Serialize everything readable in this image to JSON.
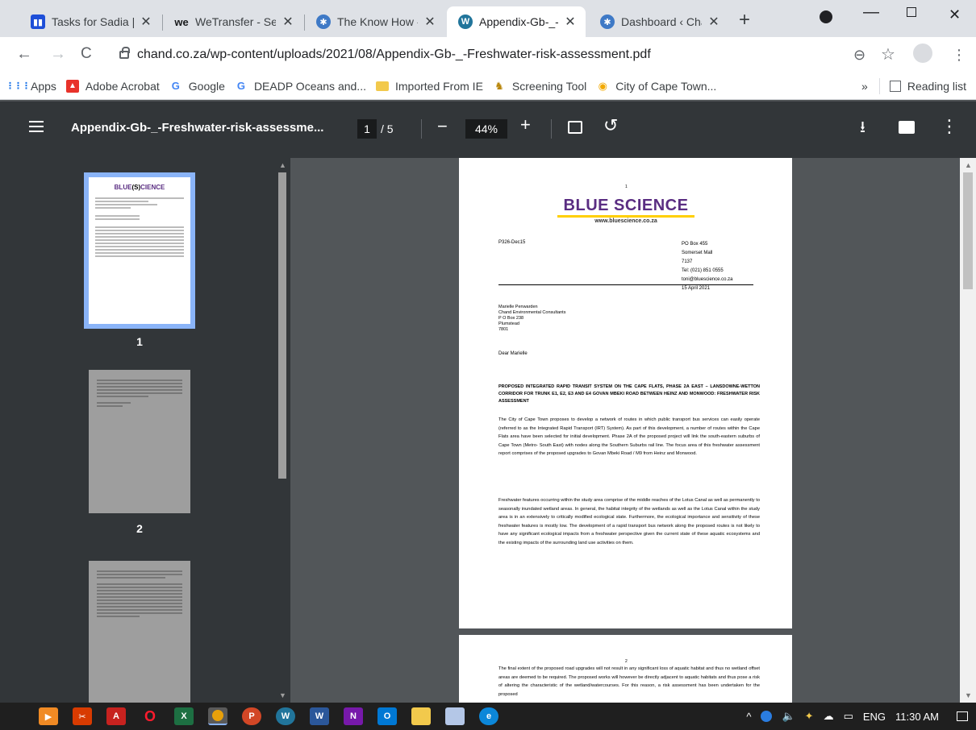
{
  "tabs": [
    {
      "title": "Tasks for Sadia |",
      "favicon": "trello-icon",
      "color": "#0052cc",
      "glyph": "▮▮"
    },
    {
      "title": "WeTransfer - Ser",
      "favicon": "wetransfer-icon",
      "color": "#17181a",
      "glyph": "we"
    },
    {
      "title": "The Know How -",
      "favicon": "cogs-icon",
      "color": "#3e79c6",
      "glyph": "✱"
    },
    {
      "title": "Appendix-Gb-_-",
      "favicon": "wordpress-icon",
      "color": "#21759b",
      "glyph": "W"
    },
    {
      "title": "Dashboard ‹ Cha",
      "favicon": "cogs-icon",
      "color": "#3e79c6",
      "glyph": "✱"
    }
  ],
  "address_bar": {
    "url": "chand.co.za/wp-content/uploads/2021/08/Appendix-Gb-_-Freshwater-risk-assessment.pdf"
  },
  "bookmarks": {
    "items": [
      {
        "label": "Apps",
        "icon": "apps-grid-icon",
        "color": "#1a73e8",
        "glyph": "⋮⋮"
      },
      {
        "label": "Adobe Acrobat",
        "icon": "adobe-acrobat-icon",
        "color": "#e8322a",
        "glyph": "▲"
      },
      {
        "label": "Google",
        "icon": "google-icon",
        "color": "#4285f4",
        "glyph": "G"
      },
      {
        "label": "DEADP Oceans and...",
        "icon": "google-icon",
        "color": "#4285f4",
        "glyph": "G"
      },
      {
        "label": "Imported From IE",
        "icon": "folder-icon",
        "color": "#f2c94c",
        "glyph": "▬"
      },
      {
        "label": "Screening Tool",
        "icon": "coat-of-arms-icon",
        "color": "#b8860b",
        "glyph": "♞"
      },
      {
        "label": "City of Cape Town...",
        "icon": "cape-town-logo-icon",
        "color": "#f2a900",
        "glyph": "◉"
      }
    ],
    "more": "»",
    "reading_list": "Reading list"
  },
  "pdf_toolbar": {
    "title": "Appendix-Gb-_-Freshwater-risk-assessme...",
    "current_page": "1",
    "total_pages": "/ 5",
    "zoom": "44%"
  },
  "sidebar": {
    "thumbnails": [
      {
        "number": "1",
        "selected": true
      },
      {
        "number": "2",
        "selected": false
      },
      {
        "number": "",
        "selected": false
      }
    ]
  },
  "page1": {
    "page_num": "1",
    "logo_text": "BLUE SCIENCE",
    "logo_url": "www.bluescience.co.za",
    "ref": "P326-Dec15",
    "address_lines": [
      "PO Box 455",
      "Somerset Mall",
      "7137",
      "Tel: (021) 851 0555",
      "toni@bluescience.co.za",
      "15 April 2021"
    ],
    "recipient_lines": [
      "Marielle Penwarden",
      "Chand Environmental Consultants",
      "P O Box 238",
      "Plumstead",
      "7801"
    ],
    "salutation": "Dear Marielle",
    "heading": "PROPOSED INTEGRATED RAPID TRANSIT SYSTEM ON THE CAPE FLATS, PHASE 2A EAST – LANSDOWNE-WETTON CORRIDOR FOR TRUNK E1, E2, E3 AND E4 GOVAN MBEKI ROAD BETWEEN HEINZ AND MONWOOD: FRESHWATER RISK ASSESSMENT",
    "para1": "The City of Cape Town proposes to develop a network of routes in which public transport bus services can easily operate (referred to as the Integrated Rapid Transport (IRT) System). As part of this development, a number of routes within the Cape Flats area have been selected for initial development. Phase 2A of the proposed project will link the south-eastern suburbs of Cape Town (Metro- South East) with nodes along the Southern Suburbs rail line. The focus area of this freshwater assessment report comprises of the proposed upgrades to Govan Mbeki Road / M9 from Heinz and Monwood.",
    "para2": "Freshwater features occurring within the study area comprise of the middle reaches of the Lotus Canal as well as permanently to seasonally inundated wetland areas. In general, the habitat integrity of the wetlands as well as the Lotus Canal within the study area is in an extensively to critically modified ecological state. Furthermore, the ecological importance and sensitivity of these freshwater features is mostly low. The development of a rapid transport bus network along the proposed routes is not likely to have any significant ecological impacts from a freshwater perspective given the current state of these aquatic ecosystems and the existing impacts of the surrounding land use activities on them."
  },
  "page2": {
    "page_num": "2",
    "para": "The final extent of the proposed road upgrades will not result in any significant loss of aquatic habitat and thus no wetland offset areas are deemed to be required. The proposed works will however be directly adjacent to aquatic habitats and thus pose a risk of altering the characteristic of the wetland/watercourses. For this reason, a risk assessment has been undertaken for the proposed"
  },
  "taskbar": {
    "apps": [
      {
        "name": "vlc-icon",
        "color": "#f08a24",
        "glyph": "▶"
      },
      {
        "name": "snip-icon",
        "color": "#d83b01",
        "glyph": "✂"
      },
      {
        "name": "acrobat-icon",
        "color": "#c7221f",
        "glyph": "A"
      },
      {
        "name": "opera-icon",
        "color": "#ff1b2d",
        "glyph": "O"
      },
      {
        "name": "excel-icon",
        "color": "#1d6f42",
        "glyph": "X"
      },
      {
        "name": "chrome-icon",
        "color": "#e8a00a",
        "glyph": "●"
      },
      {
        "name": "powerpoint-icon",
        "color": "#d24726",
        "glyph": "P"
      },
      {
        "name": "wordpress-icon",
        "color": "#21759b",
        "glyph": "W"
      },
      {
        "name": "word-icon",
        "color": "#2b579a",
        "glyph": "W"
      },
      {
        "name": "onenote-icon",
        "color": "#7719aa",
        "glyph": "N"
      },
      {
        "name": "outlook-icon",
        "color": "#0078d4",
        "glyph": "O"
      },
      {
        "name": "file-explorer-icon",
        "color": "#f2c94c",
        "glyph": "▬"
      },
      {
        "name": "notes-icon",
        "color": "#b4c7e7",
        "glyph": "▮"
      },
      {
        "name": "edge-icon",
        "color": "#0c87d9",
        "glyph": "e"
      }
    ],
    "lang": "ENG",
    "time": "11:30 AM"
  }
}
